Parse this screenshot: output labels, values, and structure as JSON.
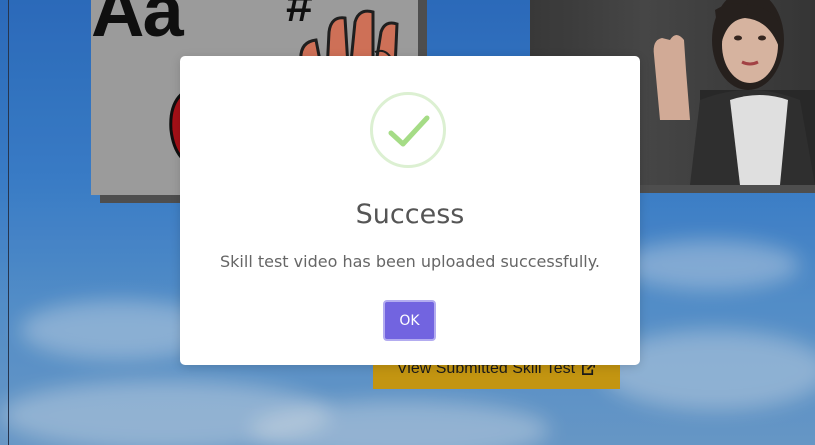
{
  "background": {
    "card_text": "Aa",
    "card_symbol": "#"
  },
  "behind_button": {
    "label": "View Submitted Skill Test",
    "icon": "external-link-icon"
  },
  "modal": {
    "icon": "success-checkmark-icon",
    "title": "Success",
    "message": "Skill test video has been uploaded successfully.",
    "ok_label": "OK"
  },
  "colors": {
    "ok_button": "#7264e0",
    "success_check": "#a5dc86",
    "view_button": "#d4a213"
  }
}
